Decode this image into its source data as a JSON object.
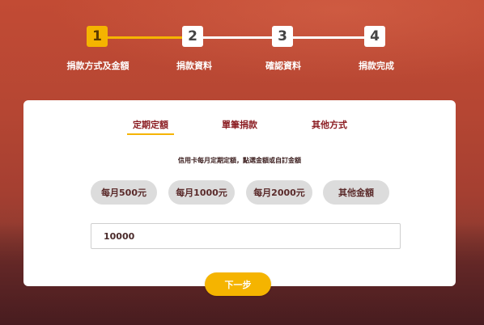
{
  "steps": [
    {
      "number": "1",
      "label": "捐款方式及金額"
    },
    {
      "number": "2",
      "label": "捐款資料"
    },
    {
      "number": "3",
      "label": "確認資料"
    },
    {
      "number": "4",
      "label": "捐款完成"
    }
  ],
  "active_step": 1,
  "tabs": [
    {
      "label": "定期定額",
      "active": true
    },
    {
      "label": "單筆捐款",
      "active": false
    },
    {
      "label": "其他方式",
      "active": false
    }
  ],
  "hint": "信用卡每月定期定額，點選金額或自訂金額",
  "amount_options": [
    "每月500元",
    "每月1000元",
    "每月2000元",
    "其他金額"
  ],
  "amount_input": {
    "value": "10000"
  },
  "next_button": "下一步",
  "colors": {
    "accent": "#f5b400",
    "tab_text": "#8b1d22",
    "option_bg": "#dcdcdc"
  }
}
